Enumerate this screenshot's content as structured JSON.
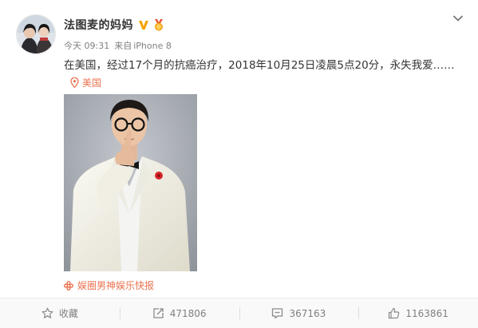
{
  "post": {
    "username": "法图麦的妈妈",
    "time": "今天 09:31",
    "source_prefix": "来自",
    "device": "iPhone 8",
    "text": "在美国，经过17个月的抗癌治疗，2018年10月25日凌晨5点20分，永失我爱……",
    "location": "美国",
    "credit": "娱圈男神娱乐快报",
    "icons": {
      "verified": "verified-v-icon",
      "medal": "vip-medal-icon",
      "location": "location-pin-icon",
      "credit": "weibo-flower-icon",
      "menu": "chevron-down-icon"
    }
  },
  "actions": {
    "favorite": "收藏",
    "repost_count": "471806",
    "comment_count": "367163",
    "like_count": "1163861"
  },
  "colors": {
    "accent": "#eb7350",
    "verified": "#f7a200",
    "text": "#333333",
    "muted": "#808080"
  }
}
